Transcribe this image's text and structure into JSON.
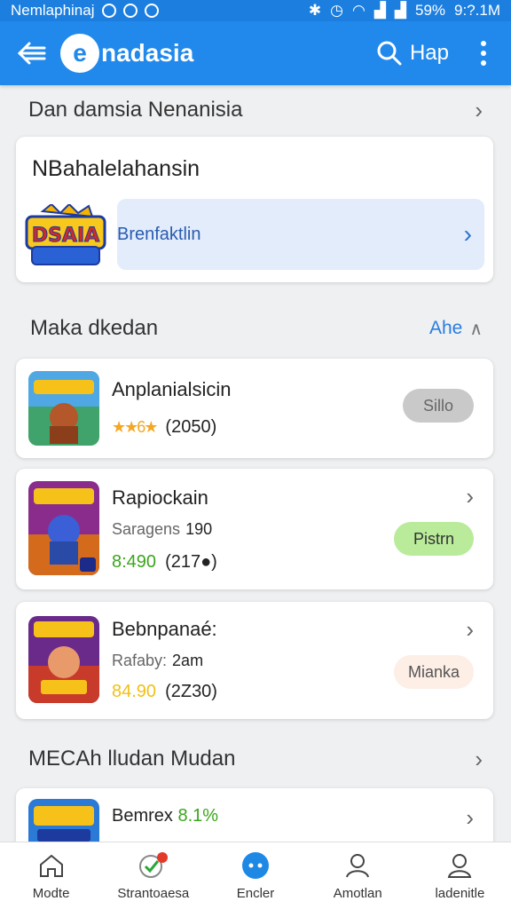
{
  "status_bar": {
    "carrier": "Nemlaphinaj",
    "battery": "59%",
    "time": "9:?.1M"
  },
  "app_bar": {
    "logo_letter": "e",
    "brand": "nadasia",
    "search_label": "Hap"
  },
  "section_top": {
    "title": "Dan damsia Nenanisia"
  },
  "featured": {
    "title": "NBahalelahansin",
    "banner_label": "Brenfaktlin"
  },
  "section_list": {
    "title": "Maka dkedan",
    "more_label": "Ahe"
  },
  "apps": [
    {
      "name": "Anplanialsicin",
      "stars": "★★6★",
      "rating_count": "(2050)",
      "button": "Sillo"
    },
    {
      "name": "Rapiockain",
      "sub_label": "Saragens",
      "sub_value": "190",
      "price": "8:490",
      "rating_count": "(217●)",
      "button": "Pistrn"
    },
    {
      "name": "Bebnpanaé:",
      "sub_label": "Rafaby:",
      "sub_value": "2am",
      "price": "84.90",
      "rating_count": "(2Z30)",
      "button": "Mianka"
    }
  ],
  "section_bottom": {
    "title": "MECAh lludan Mudan"
  },
  "partial_app": {
    "name": "Bemrex",
    "price": "8.1%"
  },
  "bottom_nav": [
    {
      "label": "Modte",
      "icon": "home-icon"
    },
    {
      "label": "Strantoaesa",
      "icon": "check-badge-icon"
    },
    {
      "label": "Encler",
      "icon": "chat-icon"
    },
    {
      "label": "Amotlan",
      "icon": "person-icon"
    },
    {
      "label": "ladenitle",
      "icon": "profile-icon"
    }
  ],
  "colors": {
    "primary": "#2189ec",
    "banner": "#e2ecfb",
    "green_pill": "#b9eb9a",
    "gray_pill": "#c9c9c9",
    "peach_pill": "#fdeee6"
  }
}
